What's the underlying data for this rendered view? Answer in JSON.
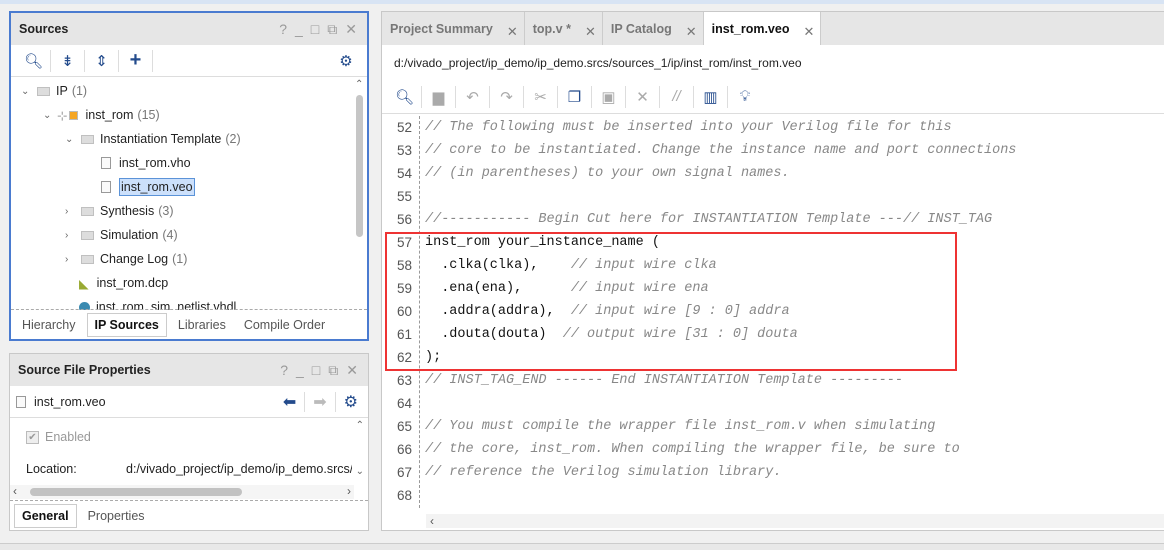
{
  "sources": {
    "title": "Sources",
    "window_controls": [
      "?",
      "_",
      "□",
      "⧉",
      "✕"
    ],
    "tree": [
      {
        "label": "IP",
        "count": "(1)"
      },
      {
        "label": "inst_rom",
        "count": "(15)"
      },
      {
        "label": "Instantiation Template",
        "count": "(2)"
      },
      {
        "label": "inst_rom.vho"
      },
      {
        "label": "inst_rom.veo"
      },
      {
        "label": "Synthesis",
        "count": "(3)"
      },
      {
        "label": "Simulation",
        "count": "(4)"
      },
      {
        "label": "Change Log",
        "count": "(1)"
      },
      {
        "label": "inst_rom.dcp"
      },
      {
        "label": "inst_rom_sim_netlist.vhdl"
      }
    ],
    "tabs": [
      "Hierarchy",
      "IP Sources",
      "Libraries",
      "Compile Order"
    ],
    "active_tab": "IP Sources"
  },
  "properties": {
    "title": "Source File Properties",
    "file": "inst_rom.veo",
    "enabled_label": "Enabled",
    "enabled": true,
    "location_label": "Location:",
    "location_value": "d:/vivado_project/ip_demo/ip_demo.srcs/",
    "tabs": [
      "General",
      "Properties"
    ],
    "active_tab": "General"
  },
  "editor": {
    "tabs": [
      "Project Summary",
      "top.v *",
      "IP Catalog",
      "inst_rom.veo"
    ],
    "active_tab": "inst_rom.veo",
    "path": "d:/vivado_project/ip_demo/ip_demo.srcs/sources_1/ip/inst_rom/inst_rom.veo",
    "highlight_color": "#ee3333",
    "lines": [
      {
        "n": "52",
        "code": "",
        "comment": "// The following must be inserted into your Verilog file for this"
      },
      {
        "n": "53",
        "code": "",
        "comment": "// core to be instantiated. Change the instance name and port connections"
      },
      {
        "n": "54",
        "code": "",
        "comment": "// (in parentheses) to your own signal names."
      },
      {
        "n": "55",
        "code": "",
        "comment": ""
      },
      {
        "n": "56",
        "code": "",
        "comment": "//----------- Begin Cut here for INSTANTIATION Template ---// INST_TAG"
      },
      {
        "n": "57",
        "code": "inst_rom your_instance_name (",
        "comment": ""
      },
      {
        "n": "58",
        "code": "  .clka(clka),    ",
        "comment": "// input wire clka"
      },
      {
        "n": "59",
        "code": "  .ena(ena),      ",
        "comment": "// input wire ena"
      },
      {
        "n": "60",
        "code": "  .addra(addra),  ",
        "comment": "// input wire [9 : 0] addra"
      },
      {
        "n": "61",
        "code": "  .douta(douta)  ",
        "comment": "// output wire [31 : 0] douta"
      },
      {
        "n": "62",
        "code": ");",
        "comment": ""
      },
      {
        "n": "63",
        "code": "",
        "comment": "// INST_TAG_END ------ End INSTANTIATION Template ---------"
      },
      {
        "n": "64",
        "code": "",
        "comment": ""
      },
      {
        "n": "65",
        "code": "",
        "comment": "// You must compile the wrapper file inst_rom.v when simulating"
      },
      {
        "n": "66",
        "code": "",
        "comment": "// the core, inst_rom. When compiling the wrapper file, be sure to"
      },
      {
        "n": "67",
        "code": "",
        "comment": "// reference the Verilog simulation library."
      },
      {
        "n": "68",
        "code": "",
        "comment": ""
      }
    ]
  }
}
